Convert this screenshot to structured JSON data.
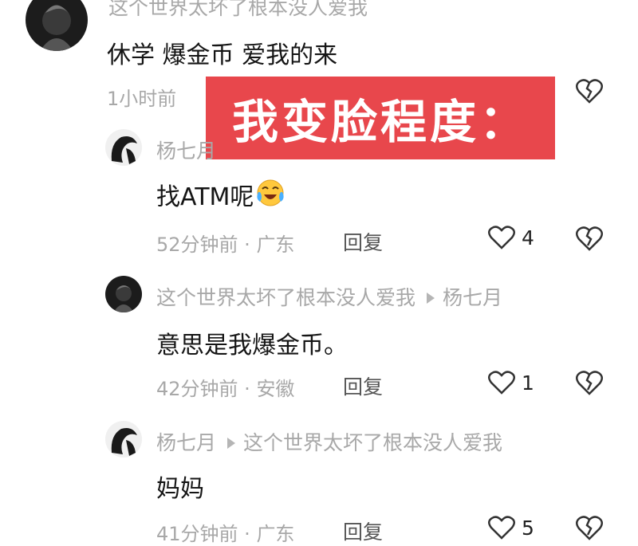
{
  "comments": [
    {
      "username": "这个世界太坏了根本没人爱我",
      "content": "休学 爆金币 爱我的来",
      "time": "1小时前",
      "location": "",
      "reply_label": ""
    },
    {
      "username": "杨七月",
      "content": "找ATM呢",
      "emoji_icon": "crying-laughing-emoji-icon",
      "time": "52分钟前",
      "location": "广东",
      "reply_label": "回复",
      "likes": "4"
    },
    {
      "username": "这个世界太坏了根本没人爱我",
      "reply_to": "杨七月",
      "content": "意思是我爆金币。",
      "time": "42分钟前",
      "location": "安徽",
      "reply_label": "回复",
      "likes": "1"
    },
    {
      "username": "杨七月",
      "reply_to": "这个世界太坏了根本没人爱我",
      "content": "妈妈",
      "time": "41分钟前",
      "location": "广东",
      "reply_label": "回复",
      "likes": "5"
    }
  ],
  "overlay_caption": "我变脸程度：",
  "colors": {
    "overlay": "#e8474c",
    "meta": "#a8a8a8",
    "text": "#151515"
  },
  "icons": [
    "heart-outline-icon",
    "broken-heart-icon",
    "reply-arrow-icon"
  ]
}
